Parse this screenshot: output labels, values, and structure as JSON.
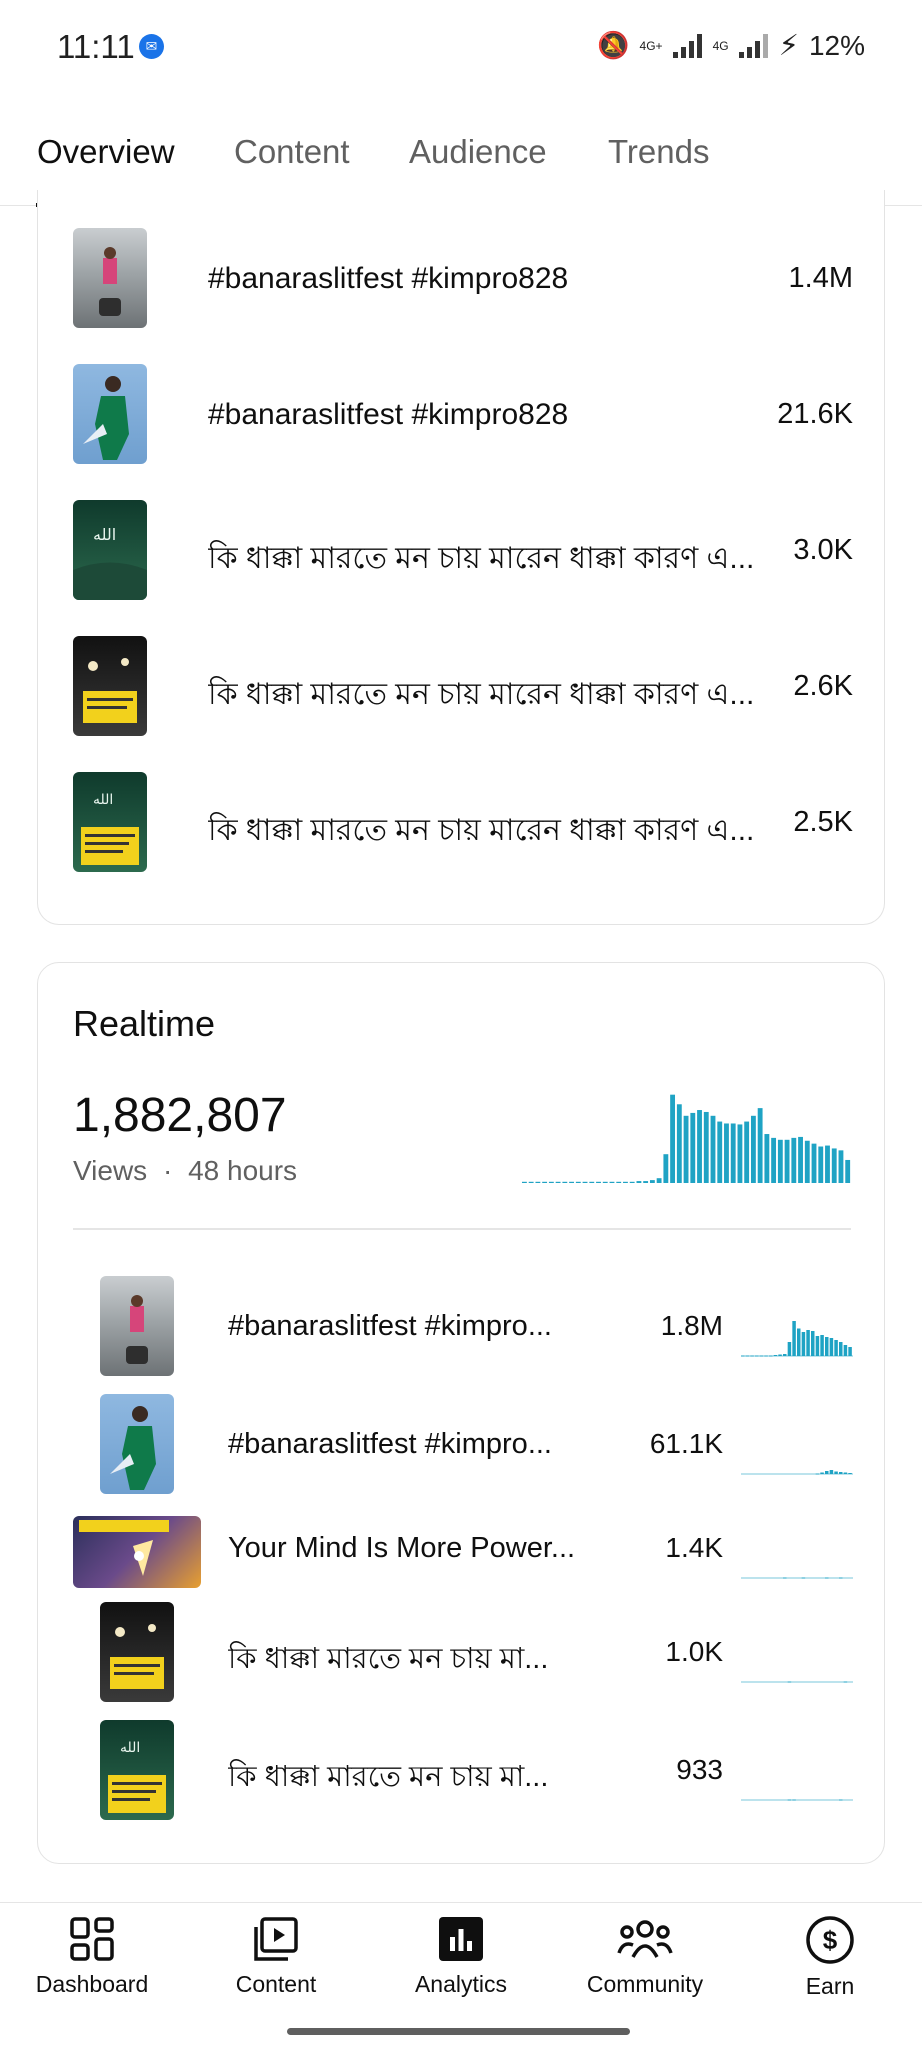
{
  "status_bar": {
    "time": "11:11",
    "network1": "4G+",
    "network2": "4G",
    "battery": "12%"
  },
  "tabs": [
    {
      "label": "Overview",
      "active": true
    },
    {
      "label": "Content",
      "active": false
    },
    {
      "label": "Audience",
      "active": false
    },
    {
      "label": "Trends",
      "active": false
    }
  ],
  "top_content": {
    "rows": [
      {
        "title": "#banaraslitfest #kimpro828",
        "value": "1.4M",
        "thumb": "corridor"
      },
      {
        "title": "#banaraslitfest #kimpro828",
        "value": "21.6K",
        "thumb": "green-suit"
      },
      {
        "title": "কি ধাক্কা মারতে মন চায় মারেন ধাক্কা কারণ এ...",
        "value": "3.0K",
        "thumb": "green-allah"
      },
      {
        "title": "কি ধাক্কা মারতে মন চায় মারেন ধাক্কা কারণ এ...",
        "value": "2.6K",
        "thumb": "night-crowd"
      },
      {
        "title": "কি ধাক্কা মারতে মন চায় মারেন ধাক্কা কারণ এ...",
        "value": "2.5K",
        "thumb": "green-allah-text"
      }
    ]
  },
  "realtime": {
    "title": "Realtime",
    "views": "1,882,807",
    "views_label": "Views",
    "separator": "·",
    "period": "48 hours",
    "accent_color": "#1fa3c4",
    "chart_data": {
      "type": "bar",
      "values": [
        0,
        0,
        0,
        0,
        0,
        0,
        0,
        0,
        0,
        0,
        0,
        1,
        1,
        1,
        1,
        1,
        1,
        2,
        2,
        3,
        5,
        30,
        92,
        82,
        70,
        73,
        76,
        74,
        70,
        64,
        62,
        62,
        61,
        64,
        70,
        78,
        51,
        47,
        45,
        45,
        47,
        48,
        44,
        41,
        38,
        39,
        36,
        34,
        24
      ],
      "ylim": [
        0,
        100
      ]
    },
    "rows": [
      {
        "title": "#banaraslitfest #kimpro...",
        "value": "1.8M",
        "thumb": "corridor",
        "spark": [
          1,
          1,
          1,
          1,
          1,
          1,
          1,
          2,
          3,
          4,
          28,
          70,
          55,
          48,
          52,
          50,
          40,
          42,
          38,
          36,
          32,
          28,
          22,
          18
        ]
      },
      {
        "title": "#banaraslitfest #kimpro...",
        "value": "61.1K",
        "thumb": "green-suit",
        "spark": [
          0,
          0,
          0,
          0,
          0,
          0,
          0,
          0,
          0,
          0,
          0,
          0,
          0,
          0,
          0,
          0,
          1,
          3,
          6,
          8,
          5,
          4,
          3,
          2
        ]
      },
      {
        "title": "Your Mind Is More Power...",
        "value": "1.4K",
        "thumb": "believe",
        "spark": [
          0,
          0,
          0,
          0,
          0,
          0,
          0,
          0,
          0,
          1,
          0,
          0,
          0,
          1,
          0,
          0,
          0,
          0,
          1,
          0,
          0,
          1,
          0,
          0
        ]
      },
      {
        "title": "কি ধাক্কা মারতে মন চায় মা...",
        "value": "1.0K",
        "thumb": "night-crowd",
        "spark": [
          0,
          0,
          0,
          0,
          0,
          0,
          0,
          0,
          0,
          0,
          1,
          0,
          0,
          0,
          0,
          0,
          0,
          0,
          0,
          0,
          0,
          0,
          1,
          0
        ]
      },
      {
        "title": "কি ধাক্কা মারতে মন চায় মা...",
        "value": "933",
        "thumb": "green-allah-text",
        "spark": [
          0,
          0,
          0,
          0,
          0,
          0,
          0,
          0,
          0,
          0,
          1,
          1,
          0,
          0,
          0,
          0,
          0,
          0,
          0,
          0,
          0,
          1,
          0,
          0
        ]
      }
    ]
  },
  "bottom_nav": [
    {
      "label": "Dashboard",
      "icon": "dashboard-icon"
    },
    {
      "label": "Content",
      "icon": "content-icon"
    },
    {
      "label": "Analytics",
      "icon": "analytics-icon",
      "active": true
    },
    {
      "label": "Community",
      "icon": "community-icon"
    },
    {
      "label": "Earn",
      "icon": "earn-icon"
    }
  ]
}
